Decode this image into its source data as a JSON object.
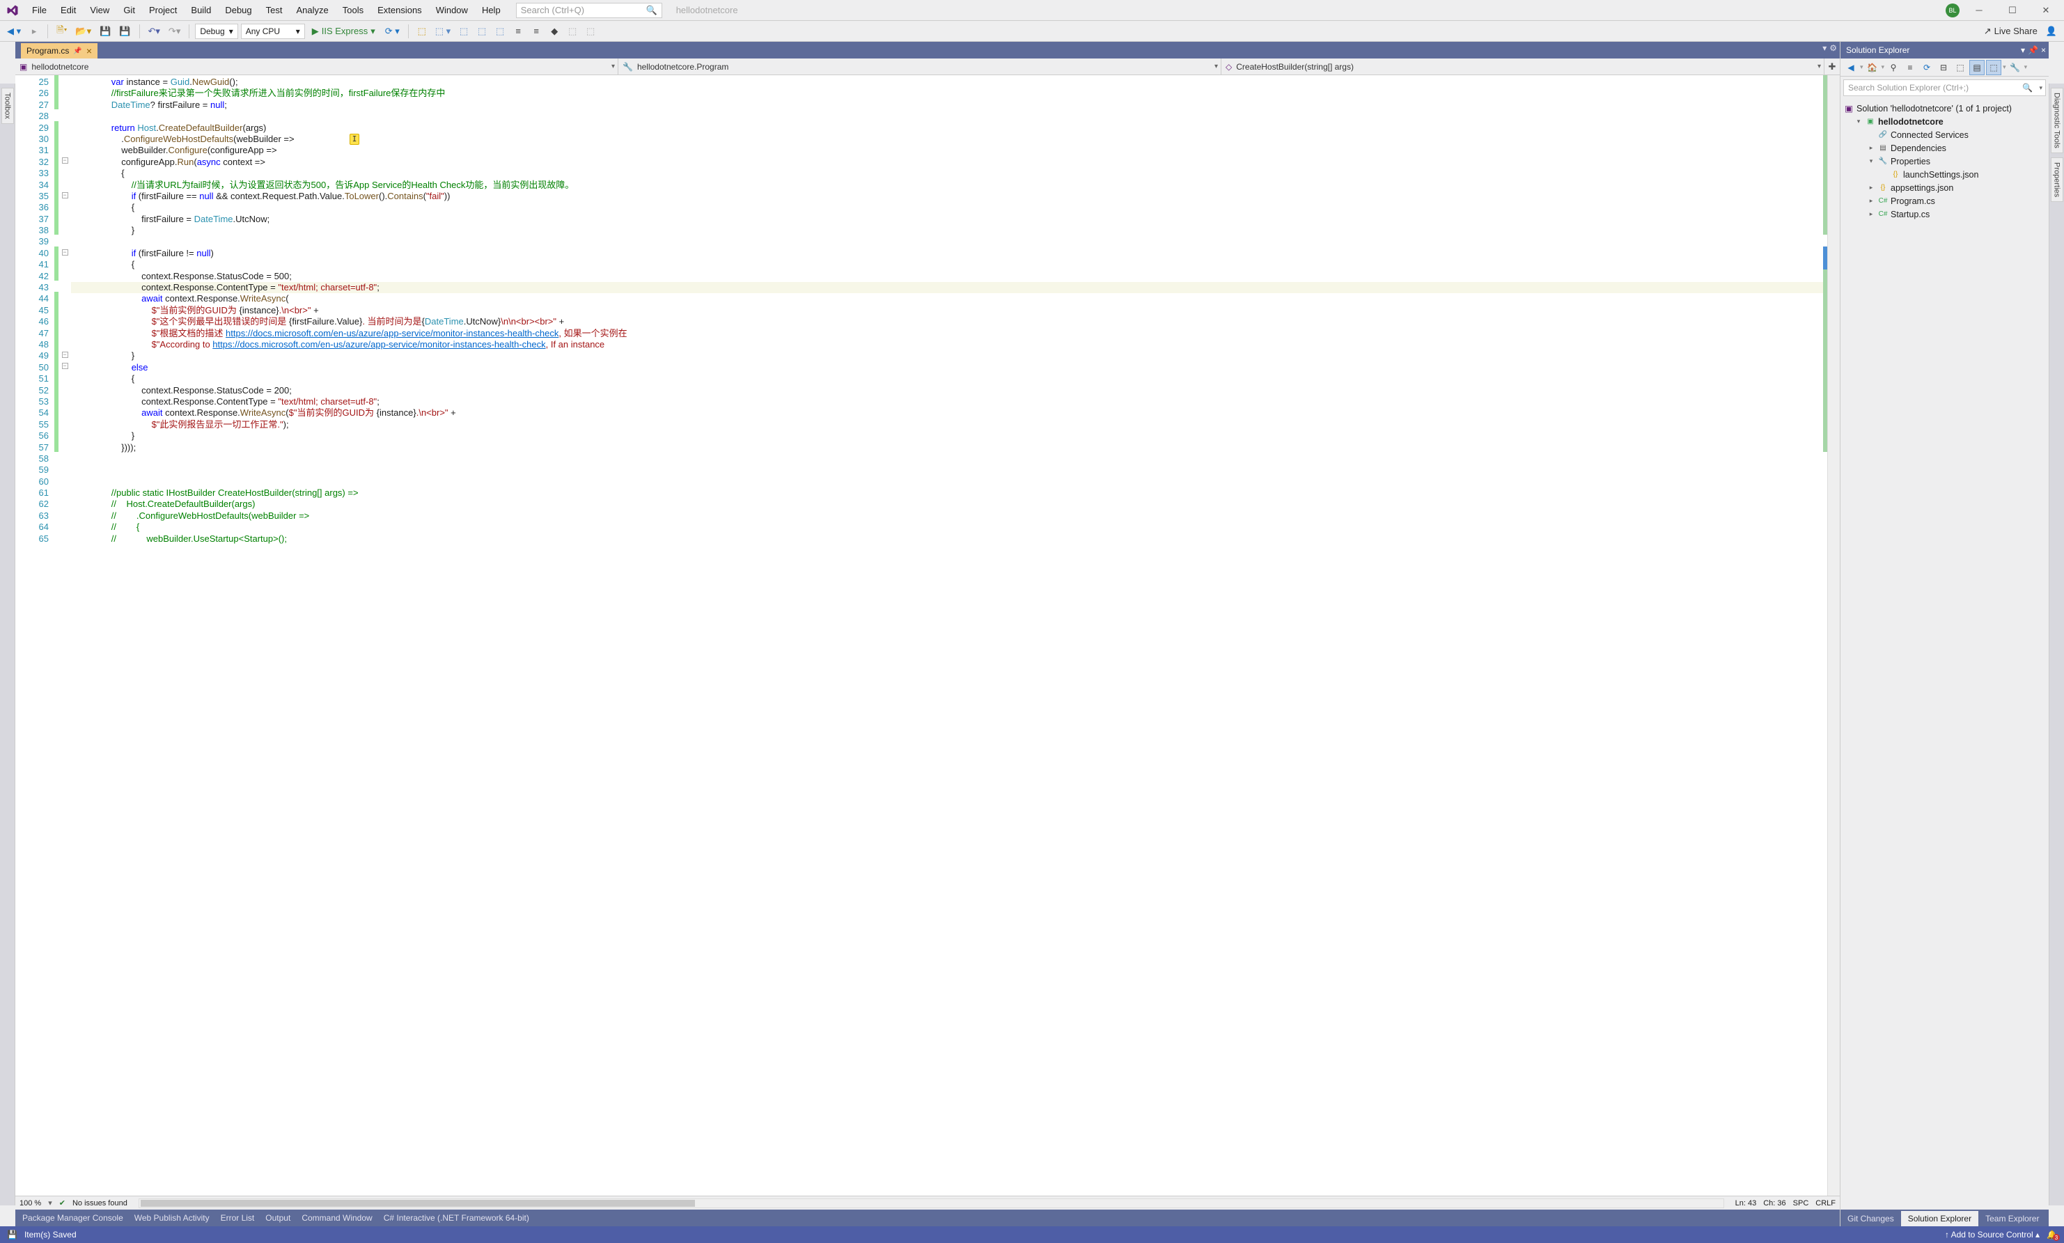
{
  "title": {
    "project": "hellodotnetcore",
    "user_initials": "BL"
  },
  "menu": [
    "File",
    "Edit",
    "View",
    "Git",
    "Project",
    "Build",
    "Debug",
    "Test",
    "Analyze",
    "Tools",
    "Extensions",
    "Window",
    "Help"
  ],
  "search_placeholder": "Search (Ctrl+Q)",
  "toolbar": {
    "config": "Debug",
    "platform": "Any CPU",
    "run_target": "IIS Express",
    "live_share": "Live Share"
  },
  "left_rail": [
    "Toolbox"
  ],
  "right_rail": [
    "Diagnostic Tools",
    "Properties"
  ],
  "doc_tabs": [
    {
      "label": "Program.cs",
      "pinned": true
    }
  ],
  "nav": {
    "scope": "hellodotnetcore",
    "class": "hellodotnetcore.Program",
    "member": "CreateHostBuilder(string[] args)"
  },
  "code_start_line": 25,
  "code_lines": [
    {
      "indent": 16,
      "segs": [
        {
          "t": "var",
          "c": "kw"
        },
        {
          "t": " instance = "
        },
        {
          "t": "Guid",
          "c": "ty"
        },
        {
          "t": "."
        },
        {
          "t": "NewGuid",
          "c": "mth"
        },
        {
          "t": "();"
        }
      ]
    },
    {
      "indent": 16,
      "segs": [
        {
          "t": "//firstFailure来记录第一个失败请求所进入当前实例的时间，firstFailure保存在内存中",
          "c": "cmt"
        }
      ]
    },
    {
      "indent": 16,
      "segs": [
        {
          "t": "DateTime",
          "c": "ty"
        },
        {
          "t": "? firstFailure = "
        },
        {
          "t": "null",
          "c": "kw"
        },
        {
          "t": ";"
        }
      ]
    },
    {
      "indent": 16,
      "segs": []
    },
    {
      "indent": 16,
      "segs": [
        {
          "t": "return",
          "c": "kw"
        },
        {
          "t": " "
        },
        {
          "t": "Host",
          "c": "ty"
        },
        {
          "t": "."
        },
        {
          "t": "CreateDefaultBuilder",
          "c": "mth"
        },
        {
          "t": "(args)"
        }
      ]
    },
    {
      "indent": 20,
      "segs": [
        {
          "t": "."
        },
        {
          "t": "ConfigureWebHostDefaults",
          "c": "mth"
        },
        {
          "t": "(webBuilder =>"
        }
      ]
    },
    {
      "indent": 20,
      "segs": [
        {
          "t": "webBuilder."
        },
        {
          "t": "Configure",
          "c": "mth"
        },
        {
          "t": "(configureApp =>"
        }
      ]
    },
    {
      "indent": 20,
      "segs": [
        {
          "t": "configureApp."
        },
        {
          "t": "Run",
          "c": "mth"
        },
        {
          "t": "("
        },
        {
          "t": "async",
          "c": "kw"
        },
        {
          "t": " context =>"
        }
      ]
    },
    {
      "indent": 20,
      "segs": [
        {
          "t": "{"
        }
      ]
    },
    {
      "indent": 24,
      "segs": [
        {
          "t": "//当请求URL为fail时候，认为设置返回状态为500，告诉App Service的Health Check功能，当前实例出现故障。",
          "c": "cmt"
        }
      ]
    },
    {
      "indent": 24,
      "segs": [
        {
          "t": "if",
          "c": "kw"
        },
        {
          "t": " (firstFailure == "
        },
        {
          "t": "null",
          "c": "kw"
        },
        {
          "t": " && context.Request.Path.Value."
        },
        {
          "t": "ToLower",
          "c": "mth"
        },
        {
          "t": "()."
        },
        {
          "t": "Contains",
          "c": "mth"
        },
        {
          "t": "("
        },
        {
          "t": "\"fail\"",
          "c": "str"
        },
        {
          "t": "))"
        }
      ]
    },
    {
      "indent": 24,
      "segs": [
        {
          "t": "{"
        }
      ]
    },
    {
      "indent": 28,
      "segs": [
        {
          "t": "firstFailure = "
        },
        {
          "t": "DateTime",
          "c": "ty"
        },
        {
          "t": ".UtcNow;"
        }
      ]
    },
    {
      "indent": 24,
      "segs": [
        {
          "t": "}"
        }
      ]
    },
    {
      "indent": 24,
      "segs": []
    },
    {
      "indent": 24,
      "segs": [
        {
          "t": "if",
          "c": "kw"
        },
        {
          "t": " (firstFailure != "
        },
        {
          "t": "null",
          "c": "kw"
        },
        {
          "t": ")"
        }
      ]
    },
    {
      "indent": 24,
      "segs": [
        {
          "t": "{"
        }
      ]
    },
    {
      "indent": 28,
      "segs": [
        {
          "t": "context.Response.StatusCode = 500;"
        }
      ]
    },
    {
      "indent": 28,
      "hl": true,
      "segs": [
        {
          "t": "context.Response.ContentType = "
        },
        {
          "t": "\"text/html; charset=utf-8\"",
          "c": "str"
        },
        {
          "t": ";"
        }
      ]
    },
    {
      "indent": 28,
      "segs": [
        {
          "t": "await",
          "c": "kw"
        },
        {
          "t": " context.Response."
        },
        {
          "t": "WriteAsync",
          "c": "mth"
        },
        {
          "t": "("
        }
      ]
    },
    {
      "indent": 32,
      "segs": [
        {
          "t": "$\"当前实例的GUID为 ",
          "c": "str"
        },
        {
          "t": "{instance}"
        },
        {
          "t": ".\\n<br>\"",
          "c": "str"
        },
        {
          "t": " +"
        }
      ]
    },
    {
      "indent": 32,
      "segs": [
        {
          "t": "$\"这个实例最早出现错误的时间是 ",
          "c": "str"
        },
        {
          "t": "{firstFailure.Value}"
        },
        {
          "t": ". 当前时间为是",
          "c": "str"
        },
        {
          "t": "{"
        },
        {
          "t": "DateTime",
          "c": "ty"
        },
        {
          "t": ".UtcNow}"
        },
        {
          "t": "\\n\\n<br><br>\"",
          "c": "str"
        },
        {
          "t": " +"
        }
      ]
    },
    {
      "indent": 32,
      "segs": [
        {
          "t": "$\"根据文档的描述 ",
          "c": "str"
        },
        {
          "t": "https://docs.microsoft.com/en-us/azure/app-service/monitor-instances-health-check",
          "c": "url"
        },
        {
          "t": ", 如果一个实例在",
          "c": "str"
        }
      ]
    },
    {
      "indent": 32,
      "segs": [
        {
          "t": "$\"According to ",
          "c": "str"
        },
        {
          "t": "https://docs.microsoft.com/en-us/azure/app-service/monitor-instances-health-check",
          "c": "url"
        },
        {
          "t": ", If an instance",
          "c": "str"
        }
      ]
    },
    {
      "indent": 24,
      "segs": [
        {
          "t": "}"
        }
      ]
    },
    {
      "indent": 24,
      "segs": [
        {
          "t": "else",
          "c": "kw"
        }
      ]
    },
    {
      "indent": 24,
      "segs": [
        {
          "t": "{"
        }
      ]
    },
    {
      "indent": 28,
      "segs": [
        {
          "t": "context.Response.StatusCode = 200;"
        }
      ]
    },
    {
      "indent": 28,
      "segs": [
        {
          "t": "context.Response.ContentType = "
        },
        {
          "t": "\"text/html; charset=utf-8\"",
          "c": "str"
        },
        {
          "t": ";"
        }
      ]
    },
    {
      "indent": 28,
      "segs": [
        {
          "t": "await",
          "c": "kw"
        },
        {
          "t": " context.Response."
        },
        {
          "t": "WriteAsync",
          "c": "mth"
        },
        {
          "t": "("
        },
        {
          "t": "$\"当前实例的GUID为 ",
          "c": "str"
        },
        {
          "t": "{instance}"
        },
        {
          "t": ".\\n<br>\"",
          "c": "str"
        },
        {
          "t": " +"
        }
      ]
    },
    {
      "indent": 32,
      "segs": [
        {
          "t": "$\"此实例报告显示一切工作正常.\"",
          "c": "str"
        },
        {
          "t": ");"
        }
      ]
    },
    {
      "indent": 24,
      "segs": [
        {
          "t": "}"
        }
      ]
    },
    {
      "indent": 20,
      "segs": [
        {
          "t": "})));"
        }
      ]
    },
    {
      "indent": 20,
      "segs": []
    },
    {
      "indent": 20,
      "segs": []
    },
    {
      "indent": 20,
      "segs": []
    },
    {
      "indent": 16,
      "segs": [
        {
          "t": "//public static IHostBuilder CreateHostBuilder(string[] args) =>",
          "c": "cmt"
        }
      ]
    },
    {
      "indent": 16,
      "segs": [
        {
          "t": "//    Host.CreateDefaultBuilder(args)",
          "c": "cmt"
        }
      ]
    },
    {
      "indent": 16,
      "segs": [
        {
          "t": "//        .ConfigureWebHostDefaults(webBuilder =>",
          "c": "cmt"
        }
      ]
    },
    {
      "indent": 16,
      "segs": [
        {
          "t": "//        {",
          "c": "cmt"
        }
      ]
    },
    {
      "indent": 16,
      "segs": [
        {
          "t": "//            webBuilder.UseStartup<Startup>();",
          "c": "cmt"
        }
      ]
    }
  ],
  "outline_marks": {
    "32": "-",
    "35": "-",
    "40": "-",
    "49": "-",
    "50": "-"
  },
  "cursor_mark_line": 30,
  "zoom": {
    "percent": "100 %",
    "issues": "No issues found",
    "ln": "Ln: 43",
    "ch": "Ch: 36",
    "spc": "SPC",
    "crlf": "CRLF"
  },
  "solution": {
    "title": "Solution Explorer",
    "search_placeholder": "Search Solution Explorer (Ctrl+;)",
    "root": "Solution 'hellodotnetcore' (1 of 1 project)",
    "tree": [
      {
        "l": 2,
        "exp": "▾",
        "ico": "csproj",
        "label": "hellodotnetcore",
        "bold": true
      },
      {
        "l": 3,
        "exp": "",
        "ico": "connected",
        "label": "Connected Services"
      },
      {
        "l": 3,
        "exp": "▸",
        "ico": "deps",
        "label": "Dependencies"
      },
      {
        "l": 3,
        "exp": "▾",
        "ico": "folder",
        "label": "Properties"
      },
      {
        "l": 4,
        "exp": "",
        "ico": "json",
        "label": "launchSettings.json"
      },
      {
        "l": 3,
        "exp": "▸",
        "ico": "json",
        "label": "appsettings.json"
      },
      {
        "l": 3,
        "exp": "▸",
        "ico": "cs",
        "label": "Program.cs"
      },
      {
        "l": 3,
        "exp": "▸",
        "ico": "cs",
        "label": "Startup.cs"
      }
    ],
    "bottom_tabs": [
      "Git Changes",
      "Solution Explorer",
      "Team Explorer"
    ],
    "bottom_active": 1
  },
  "bottom_tools": [
    "Package Manager Console",
    "Web Publish Activity",
    "Error List",
    "Output",
    "Command Window",
    "C# Interactive (.NET Framework 64-bit)"
  ],
  "status": {
    "left": "Item(s) Saved",
    "source_control": "Add to Source Control",
    "bell_count": "3"
  }
}
